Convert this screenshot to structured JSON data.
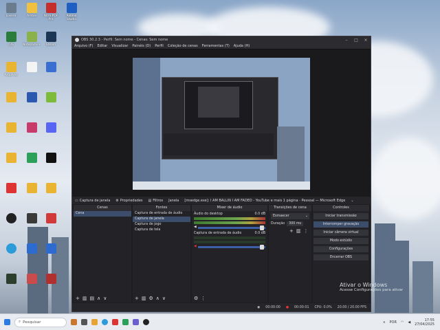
{
  "desktop": {
    "icons": [
      {
        "label": "Lixeira",
        "color": "#6b7c8e"
      },
      {
        "label": "Ambie",
        "color": "#f0c040"
      },
      {
        "label": "Nitro PDF Pro",
        "color": "#c62d2d"
      },
      {
        "label": "Roblox Studio",
        "color": "#1f5fc2"
      },
      {
        "label": "vlc.rec",
        "color": "#e07b18"
      },
      {
        "label": "GIS",
        "color": "#2a7b3c"
      },
      {
        "label": "Notepad++",
        "color": "#8bb24a"
      },
      {
        "label": "Steam",
        "color": "#1b3654"
      },
      {
        "label": "Upscayl",
        "color": "#c43b6a"
      },
      {
        "label": "Arquivos",
        "color": "#e8b432"
      }
    ],
    "watermark_title": "Ativar o Windows",
    "watermark_sub": "Acesse Configurações para ativar"
  },
  "obs": {
    "title": "OBS 30.2.3 - Perfil: Sem nome - Cenas: Sem nome",
    "menu": [
      "Arquivo (F)",
      "Editar",
      "Visualizar",
      "Painéis (D)",
      "Perfil",
      "Coleção de cenas",
      "Ferramentas (T)",
      "Ajuda (H)"
    ],
    "source_bar": {
      "source": "Captura de janela",
      "properties": "Propriedades",
      "filters": "Filtros",
      "window_label": "Janela",
      "window_value": "[msedge.exe]: I AM BALLIN I AM FADED - YouTube e mais 1 página - Pessoal — Microsoft Edge"
    },
    "docks": {
      "scenes": {
        "title": "Cenas",
        "items": [
          "Cena"
        ]
      },
      "sources": {
        "title": "Fontes",
        "items": [
          "Captura de entrada de áudio",
          "Captura de janela",
          "Captura de jogo",
          "Captura de tela"
        ]
      },
      "mixer": {
        "title": "Mixer de áudio",
        "channels": [
          {
            "name": "Áudio do desktop",
            "db": "0.0 dB",
            "level": 0.85
          },
          {
            "name": "Captura de entrada de áudio",
            "db": "0.0 dB",
            "level": 0.0
          }
        ]
      },
      "transitions": {
        "title": "Transições de cena",
        "type": "Esmaecer",
        "duration_label": "Duração",
        "duration_value": "300 ms"
      },
      "controls": {
        "title": "Controles",
        "buttons": [
          "Iniciar transmissão",
          "Interromper gravação",
          "Iniciar câmera virtual",
          "Modo estúdio",
          "Configurações",
          "Encerrar OBS"
        ]
      }
    },
    "status": {
      "stream_time": "00:00:00",
      "rec_time": "00:00:01",
      "cpu": "CPU: 0.0%",
      "fps": "20.00 / 20.00 FPS"
    }
  },
  "taskbar": {
    "search_placeholder": "Pesquisar",
    "language": "POR",
    "time": "17:55",
    "date": "27/04/2025"
  }
}
